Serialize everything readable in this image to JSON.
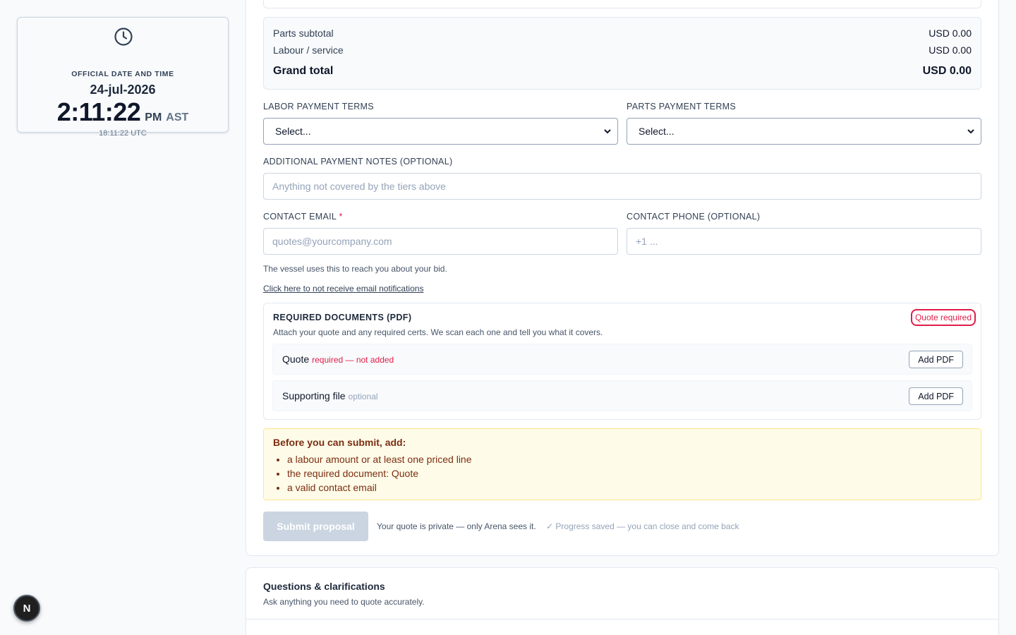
{
  "clock": {
    "label": "OFFICIAL DATE AND TIME",
    "date": "24-jul-2026",
    "time": "2:11:22",
    "ampm": "PM",
    "tz": "AST",
    "utc": "18:11:22 UTC",
    "icon": "clock-icon"
  },
  "avatar": {
    "letter": "N"
  },
  "totals": {
    "parts_label": "Parts subtotal",
    "parts_value": "USD 0.00",
    "labour_label": "Labour / service",
    "labour_value": "USD 0.00",
    "grand_label": "Grand total",
    "grand_value": "USD 0.00"
  },
  "payment_terms": {
    "labor_label": "LABOR PAYMENT TERMS",
    "labor_selected": "Select...",
    "parts_label": "PARTS PAYMENT TERMS",
    "parts_selected": "Select..."
  },
  "notes": {
    "label": "ADDITIONAL PAYMENT NOTES (OPTIONAL)",
    "placeholder": "Anything not covered by the tiers above"
  },
  "contact": {
    "email_label": "CONTACT EMAIL",
    "required_mark": "*",
    "email_placeholder": "quotes@yourcompany.com",
    "phone_label": "CONTACT PHONE (OPTIONAL)",
    "phone_placeholder": "+1 ...",
    "helper": "The vessel uses this to reach you about your bid.",
    "optout_link": "Click here to not receive email notifications"
  },
  "documents": {
    "title": "REQUIRED DOCUMENTS (PDF)",
    "description": "Attach your quote and any required certs. We scan each one and tell you what it covers.",
    "badge": "Quote required",
    "items": [
      {
        "name": "Quote",
        "status": "required — not added",
        "button": "Add PDF"
      },
      {
        "name": "Supporting file",
        "status": "optional",
        "button": "Add PDF"
      }
    ]
  },
  "warning": {
    "title": "Before you can submit, add:",
    "items": [
      "a labour amount or at least one priced line",
      "the required document: Quote",
      "a valid contact email"
    ]
  },
  "submit": {
    "button": "Submit proposal",
    "private_note": "Your quote is private — only Arena sees it.",
    "saved_note": "✓ Progress saved — you can close and come back"
  },
  "questions": {
    "title": "Questions & clarifications",
    "subtitle": "Ask anything you need to quote accurately."
  },
  "colors": {
    "accent_error": "#e11d48",
    "warning_bg": "#fefce8",
    "warning_text": "#7c2d12",
    "disabled_button": "#cbd5e1"
  }
}
